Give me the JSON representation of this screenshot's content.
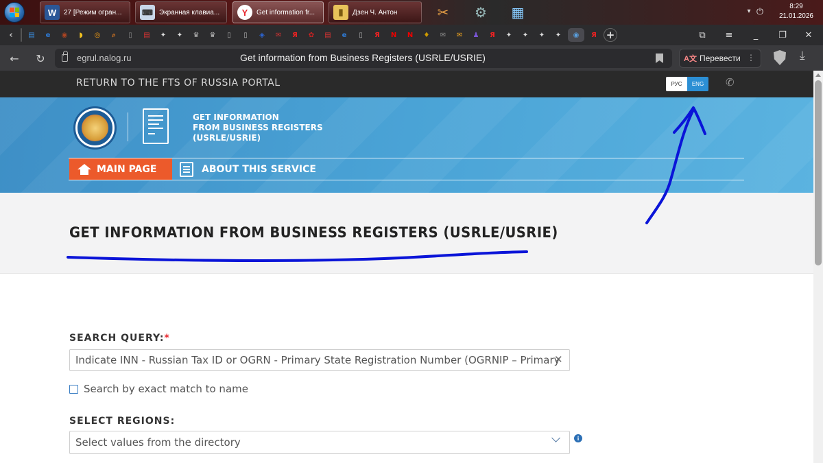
{
  "taskbar": {
    "tasks": [
      {
        "label": "27 [Режим огран...",
        "icon": "word-icon"
      },
      {
        "label": "Экранная клавиа...",
        "icon": "keyboard-icon"
      },
      {
        "label": "Get information fr...",
        "icon": "yandex-browser-icon"
      },
      {
        "label": "Дзен Ч. Антон",
        "icon": "folder-icon"
      }
    ],
    "time": "8:29",
    "date": "21.01.2026"
  },
  "browser": {
    "domain": "egrul.nalog.ru",
    "page_title": "Get information from Business Registers (USRLE/USRIE)",
    "translate_label": "Перевести",
    "tab_icons": [
      "bookmarks-icon",
      "edge-icon",
      "game-icon",
      "banana-icon",
      "ok-icon",
      "search-icon",
      "page-icon",
      "pdf-icon",
      "star-icon",
      "star-icon",
      "eagle-icon",
      "eagle-icon",
      "page-icon",
      "page-icon",
      "shield-icon",
      "mail-icon",
      "yandex-icon",
      "maple-icon",
      "pdf-icon",
      "edge-icon",
      "page-icon",
      "yandex-icon",
      "netflix-icon",
      "netflix-icon",
      "badge-icon",
      "chat-icon",
      "mail-icon",
      "person-icon",
      "yandex-icon",
      "star-icon",
      "star-icon",
      "star-icon",
      "star-icon",
      "browser-icon",
      "yandex-icon"
    ],
    "tab_glyphs": [
      "▤",
      "e",
      "◉",
      "◗",
      "◎",
      "⌕",
      "▯",
      "▤",
      "✦",
      "✦",
      "♛",
      "♛",
      "▯",
      "▯",
      "◈",
      "✉",
      "Я",
      "✿",
      "▤",
      "e",
      "▯",
      "Я",
      "N",
      "N",
      "♦",
      "✉",
      "✉",
      "♟",
      "Я",
      "✦",
      "✦",
      "✦",
      "✦",
      "◉",
      "Я"
    ],
    "new_tab_glyph": "+"
  },
  "site": {
    "return_link": "RETURN TO THE FTS OF RUSSIA PORTAL",
    "lang_rus": "РУС",
    "lang_eng": "ENG",
    "header_title_lines": [
      "GET INFORMATION",
      "FROM BUSINESS REGISTERS",
      "(USRLE/USRIE)"
    ],
    "nav_main": "MAIN PAGE",
    "nav_about": "ABOUT THIS SERVICE",
    "page_heading": "GET INFORMATION FROM BUSINESS REGISTERS (USRLE/USRIE)"
  },
  "form": {
    "search_label": "SEARCH QUERY:",
    "required_mark": "*",
    "search_placeholder": "Indicate INN - Russian Tax ID or OGRN - Primary State Registration Number (OGRNIP – Primary",
    "exact_match_label": "Search by exact match to name",
    "regions_label": "SELECT REGIONS:",
    "regions_placeholder": "Select values from the directory"
  },
  "colors": {
    "accent_orange": "#ec5a2b",
    "header_blue": "#4aa3d6",
    "eng_active": "#2c8fd4",
    "annotation_ink": "#0a14d8"
  },
  "annotation": {
    "description_tag": "hand-drawn-blue-marker",
    "marks": [
      "arrow-to-eng-button",
      "underline-under-page-heading"
    ]
  }
}
